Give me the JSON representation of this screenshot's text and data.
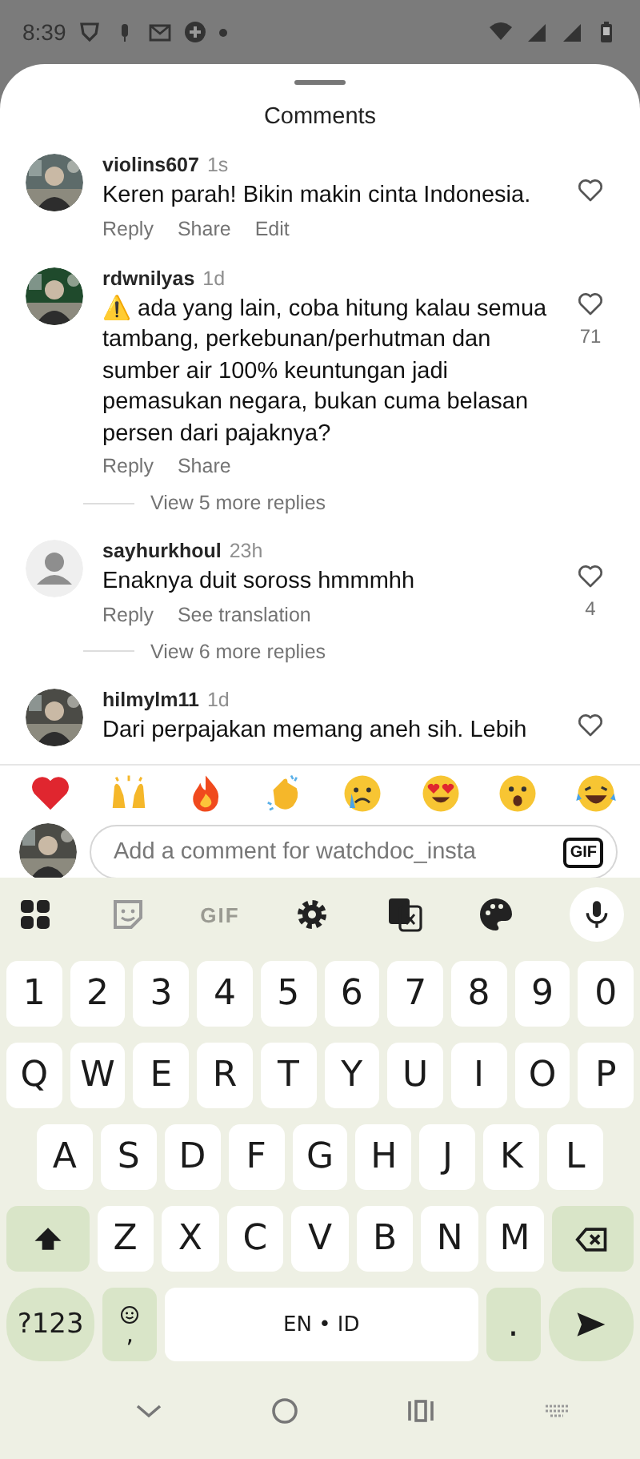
{
  "status_bar": {
    "time": "8:39"
  },
  "sheet": {
    "title": "Comments"
  },
  "comments": [
    {
      "avatar": {
        "kind": "picture"
      },
      "username": "violins607",
      "time": "1s",
      "text": "Keren parah! Bikin makin cinta Indonesia.",
      "actions": [
        "Reply",
        "Share",
        "Edit"
      ]
    },
    {
      "avatar": {
        "kind": "picture"
      },
      "username": "rdwnilyas",
      "time": "1d",
      "text": "⚠️ ada yang lain, coba hitung kalau semua tambang, perkebunan/perhutman dan sumber air 100% keuntungan jadi pemasukan negara, bukan cuma belasan persen dari pajaknya?",
      "actions": [
        "Reply",
        "Share"
      ],
      "likes": "71",
      "replies_link": "View 5 more replies"
    },
    {
      "avatar": {
        "kind": "default"
      },
      "username": "sayhurkhoul",
      "time": "23h",
      "text": "Enaknya duit soross hmmmhh",
      "actions": [
        "Reply",
        "See translation"
      ],
      "likes": "4",
      "replies_link": "View 6 more replies"
    },
    {
      "avatar": {
        "kind": "picture"
      },
      "username": "hilmylm11",
      "time": "1d",
      "text": "Dari perpajakan memang aneh sih. Lebih"
    }
  ],
  "composer": {
    "placeholder": "Add a comment for watchdoc_insta",
    "gif_badge": "GIF"
  },
  "keyboard": {
    "toolbar_gif": "GIF",
    "rows": [
      {
        "keys": [
          {
            "label": "1",
            "kind": "char"
          },
          {
            "label": "2",
            "kind": "char"
          },
          {
            "label": "3",
            "kind": "char"
          },
          {
            "label": "4",
            "kind": "char"
          },
          {
            "label": "5",
            "kind": "char"
          },
          {
            "label": "6",
            "kind": "char"
          },
          {
            "label": "7",
            "kind": "char"
          },
          {
            "label": "8",
            "kind": "char"
          },
          {
            "label": "9",
            "kind": "char"
          },
          {
            "label": "0",
            "kind": "char"
          }
        ]
      },
      {
        "keys": [
          {
            "label": "Q",
            "kind": "char"
          },
          {
            "label": "W",
            "kind": "char"
          },
          {
            "label": "E",
            "kind": "char"
          },
          {
            "label": "R",
            "kind": "char"
          },
          {
            "label": "T",
            "kind": "char"
          },
          {
            "label": "Y",
            "kind": "char"
          },
          {
            "label": "U",
            "kind": "char"
          },
          {
            "label": "I",
            "kind": "char"
          },
          {
            "label": "O",
            "kind": "char"
          },
          {
            "label": "P",
            "kind": "char"
          }
        ]
      },
      {
        "keys": [
          {
            "label": "A",
            "kind": "char"
          },
          {
            "label": "S",
            "kind": "char"
          },
          {
            "label": "D",
            "kind": "char"
          },
          {
            "label": "F",
            "kind": "char"
          },
          {
            "label": "G",
            "kind": "char"
          },
          {
            "label": "H",
            "kind": "char"
          },
          {
            "label": "J",
            "kind": "char"
          },
          {
            "label": "K",
            "kind": "char"
          },
          {
            "label": "L",
            "kind": "char"
          }
        ]
      },
      {
        "keys": [
          {
            "kind": "shift"
          },
          {
            "label": "Z",
            "kind": "char"
          },
          {
            "label": "X",
            "kind": "char"
          },
          {
            "label": "C",
            "kind": "char"
          },
          {
            "label": "V",
            "kind": "char"
          },
          {
            "label": "B",
            "kind": "char"
          },
          {
            "label": "N",
            "kind": "char"
          },
          {
            "label": "M",
            "kind": "char"
          },
          {
            "kind": "backspace"
          }
        ]
      },
      {
        "keys": [
          {
            "label": "?123",
            "kind": "mode"
          },
          {
            "label": ",",
            "kind": "emoji"
          },
          {
            "label": "EN • ID",
            "kind": "space"
          },
          {
            "label": ".",
            "kind": "period"
          },
          {
            "kind": "send"
          }
        ]
      }
    ]
  }
}
